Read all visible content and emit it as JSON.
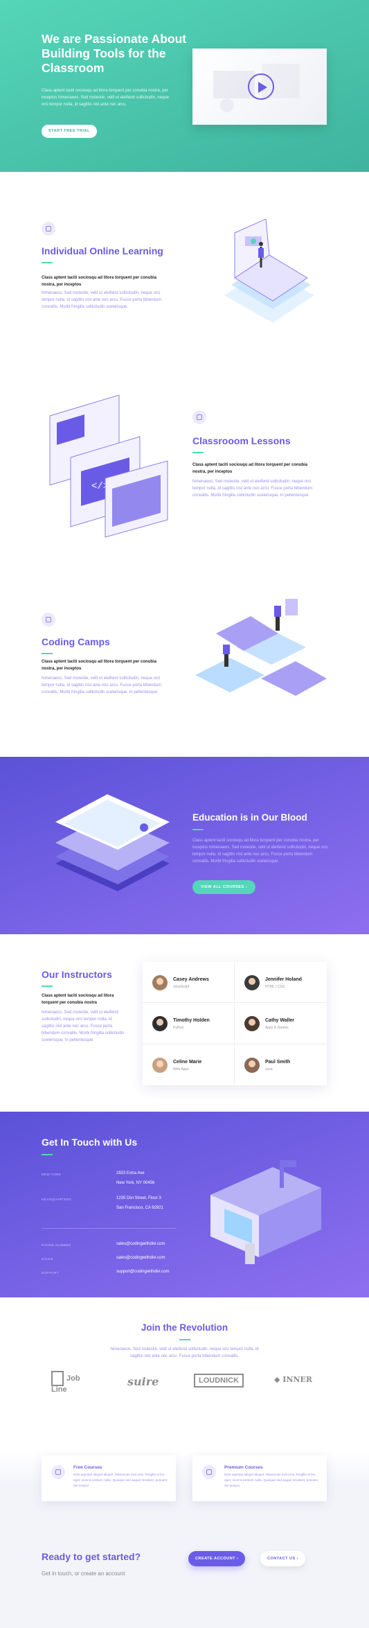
{
  "colors": {
    "teal": "#55d6b8",
    "purple": "#6a5be6",
    "purple_gradient_start": "#5a52d8",
    "purple_gradient_end": "#8e6ff0"
  },
  "hero": {
    "title": "We are Passionate About Building Tools for the Classroom",
    "text": "Class aptent taciti sociosqu ad litora torquent per conubia nostra, per inceptos himenaeos. Sed molestie, velit ut eleifend sollicitudin, neque orci tempor nulla, id sagittis nisl ante nec arcu.",
    "button": "START FREE TRIAL",
    "video_icon": "play-icon"
  },
  "features": [
    {
      "icon": "monitor-icon",
      "title": "Individual Online Learning",
      "lead": "Class aptent taciti sociosqu ad litora torquent per conubia nostra, per inceptos",
      "body": "himenaeos. Sed molestie, velit ut eleifend sollicitudin, neque orci tempor nulla, id sagittis nisl ante nec arcu. Fusce porta bibendum convallis. Morbi fringilla sollicitudin scelerisque."
    },
    {
      "icon": "document-icon",
      "title": "Classrooom Lessons",
      "lead": "Class aptent taciti sociosqu ad litora torquent per conubia nostra, per inceptos",
      "body": "himenaeos. Sed molestie, velit ut eleifend sollicitudin, neque orci tempor nulla, id sagittis nisl ante nec arcu. Fusce porta bibendum convallis. Morbi fringilla sollicitudin scelerisque. In pellentesque"
    },
    {
      "icon": "code-icon",
      "title": "Coding Camps",
      "lead": "Class aptent taciti sociosqu ad litora torquent per conubia nostra, per inceptos",
      "body": "himenaeos. Sed molestie, velit ut eleifend sollicitudin, neque orci tempor nulla, id sagittis nisl ante nec arcu. Fusce porta bibendum convallis. Morbi fringilla sollicitudin scelerisque. In pellentesque"
    }
  ],
  "education": {
    "title": "Education is in Our Blood",
    "body": "Class aptent taciti sociosqu ad litora torquent per conubia nostra, per inceptos himenaeos. Sed molestie, velit ut eleifend sollicitudin, neque orci tempor nulla, id sagittis nisl ante nec arcu. Fusce porta bibendum convallis. Morbi fringilla sollicitudin scelerisque.",
    "button": "VIEW ALL COURSES"
  },
  "instructors": {
    "title": "Our Instructors",
    "lead": "Class aptent taciti sociosqu ad litora torquent per conubia nostra",
    "body": "himenaeos. Sed molestie, velit ut eleifend sollicitudin, neque orci tempor nulla, id sagittis nisl ante nec arcu. Fusce porta bibendum convallis. Morbi fringilla sollicitudin scelerisque. In pellentesque",
    "people": [
      {
        "name": "Casey Andrews",
        "role": "JavaScript"
      },
      {
        "name": "Jennifer Holand",
        "role": "HTML / CSS"
      },
      {
        "name": "Timothy Holden",
        "role": "Python"
      },
      {
        "name": "Cathy Waller",
        "role": "Apps & Games"
      },
      {
        "name": "Celine Marie",
        "role": "Web Apps"
      },
      {
        "name": "Paul Smith",
        "role": "Java"
      }
    ]
  },
  "contact": {
    "title": "Get In Touch with Us",
    "rows": [
      {
        "label": "NEW YORK",
        "lines": [
          "2923 Extra Ave",
          "New York, NY 00456"
        ]
      },
      {
        "label": "HEADQUARTERS",
        "lines": [
          "1235 Divi Street, Floor 3",
          "San Francisco, CA 92921"
        ]
      },
      {
        "label": "PHONE NUMBER",
        "lines": [
          "sales@codingwithdivi.com"
        ]
      },
      {
        "label": "SALES",
        "lines": [
          "sales@codingwithdivi.com"
        ]
      },
      {
        "label": "SUPPORT",
        "lines": [
          "support@codingwithdivi.com"
        ]
      }
    ]
  },
  "join": {
    "title": "Join the Revolution",
    "body": "himenaeos. Sed molestie, velit ut eleifend sollicitudin, neque orci tempor nulla, id sagittis nisl ante nec arcu. Fusce porta bibendum convallis.",
    "logos": [
      "Job Line",
      "suire",
      "LOUDNICK",
      "INNER"
    ]
  },
  "courses": [
    {
      "icon": "book-icon",
      "title": "Free Courses",
      "body": "Duis egestas aliquet aliquet. Maecenas erat eros, fringilla et leo eget, viverra pretium nulla. Quisque sed augue tincidunt, posuere dui tempor."
    },
    {
      "icon": "certificate-icon",
      "title": "Premium Courses",
      "body": "Duis egestas aliquet aliquet. Maecenas erat eros, fringilla et leo eget, viverra pretium nulla. Quisque sed augue tincidunt, posuere dui tempor."
    }
  ],
  "cta": {
    "title": "Ready to get started?",
    "subtitle": "Get in touch, or create an account",
    "create_button": "CREATE ACCOUNT",
    "contact_button": "CONTACT US"
  }
}
